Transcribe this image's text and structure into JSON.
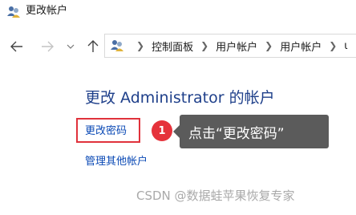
{
  "window": {
    "title": "更改帐户"
  },
  "navigation": {
    "breadcrumbs": [
      "控制面板",
      "用户帐户",
      "用户帐户"
    ],
    "truncated_next": "ι"
  },
  "main": {
    "heading": "更改 Administrator 的帐户",
    "links": {
      "change_password": "更改密码",
      "manage_other_accounts": "管理其他帐户"
    }
  },
  "annotation": {
    "step_number": "1",
    "callout_text": "点击“更改密码”",
    "highlight_color": "#e0323c"
  },
  "watermark": "CSDN @数据蛙苹果恢复专家"
}
